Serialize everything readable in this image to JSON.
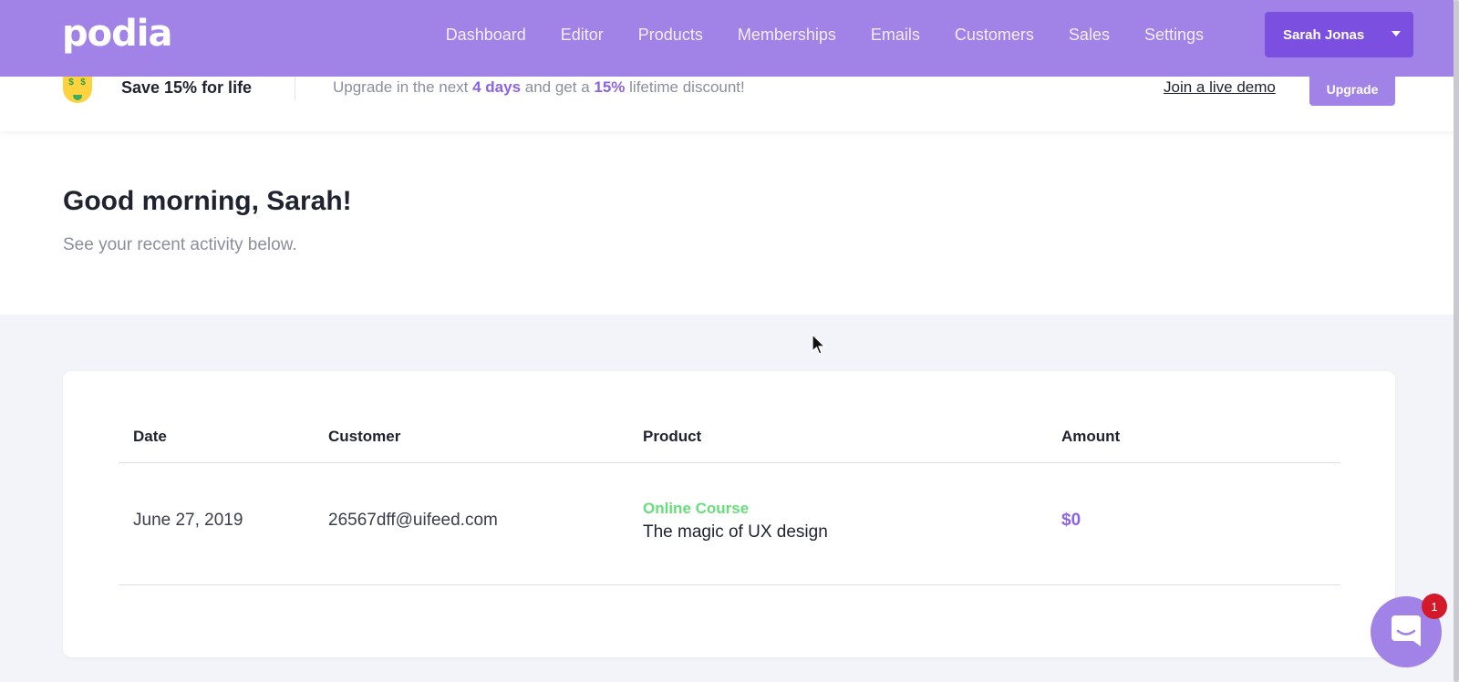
{
  "app": {
    "logo_text": "podia"
  },
  "nav": {
    "items": [
      {
        "label": "Dashboard"
      },
      {
        "label": "Editor"
      },
      {
        "label": "Products"
      },
      {
        "label": "Memberships"
      },
      {
        "label": "Emails"
      },
      {
        "label": "Customers"
      },
      {
        "label": "Sales"
      },
      {
        "label": "Settings"
      }
    ],
    "user_menu_label": "Sarah Jonas"
  },
  "promo": {
    "icon": "money-mouth-face-icon",
    "title": "Save 15% for life",
    "text_before": "Upgrade in the next ",
    "days": "4 days",
    "text_middle": " and get a ",
    "discount": "15%",
    "text_after": " lifetime discount!",
    "demo_link": "Join a live demo",
    "upgrade_button": "Upgrade"
  },
  "greeting": {
    "title": "Good morning, Sarah!",
    "subtitle": "See your recent activity below."
  },
  "sales_table": {
    "columns": [
      "Date",
      "Customer",
      "Product",
      "Amount"
    ],
    "rows": [
      {
        "date": "June 27, 2019",
        "customer": "26567dff@uifeed.com",
        "product_type": "Online Course",
        "product_name": "The magic of UX design",
        "amount": "$0"
      }
    ]
  },
  "chat": {
    "badge_count": "1"
  },
  "colors": {
    "brand": "#a183e8",
    "brand_dark": "#7b4fe0",
    "accent_text": "#8c63e6",
    "success": "#67de79",
    "badge": "#d41a2a"
  }
}
